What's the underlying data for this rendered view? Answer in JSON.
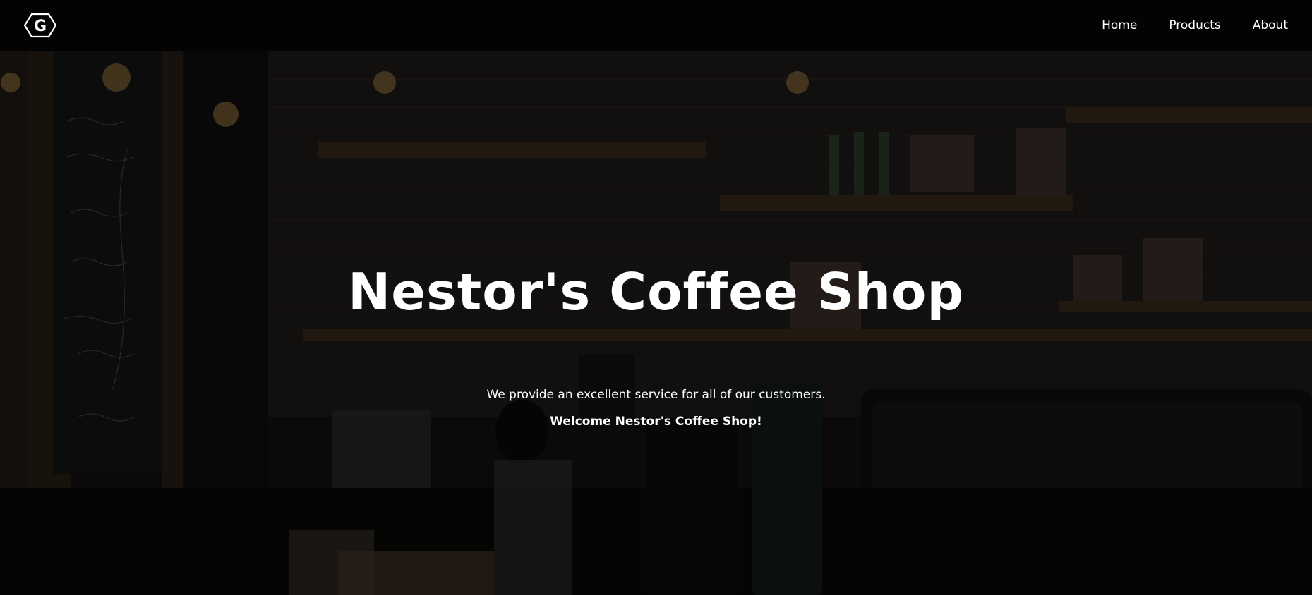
{
  "nav": {
    "logo_letter": "G",
    "links": [
      {
        "label": "Home"
      },
      {
        "label": "Products"
      },
      {
        "label": "About"
      }
    ]
  },
  "hero": {
    "title": "Nestor's Coffee Shop",
    "tagline": "We provide an excellent service for all of our customers.",
    "welcome": "Welcome Nestor's Coffee Shop!",
    "background_image": "coffee-shop-interior-photo"
  },
  "colors": {
    "navbar_bg": "#030303",
    "text": "#ffffff",
    "overlay": "rgba(0,0,0,0.42)"
  }
}
